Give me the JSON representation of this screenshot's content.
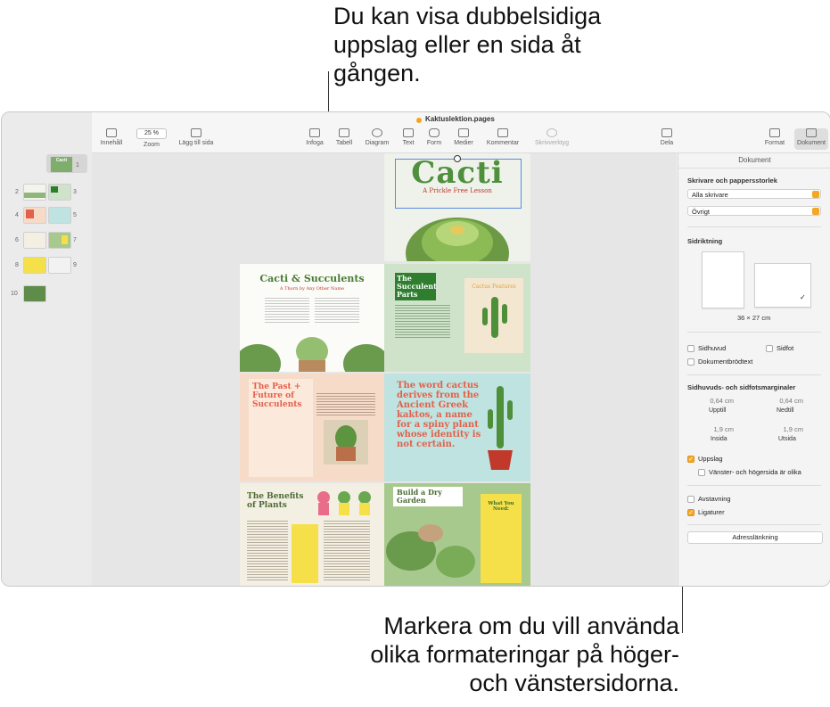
{
  "callouts": {
    "top": "Du kan visa dubbelsidiga uppslag eller en sida åt gången.",
    "bottom": "Markera om du vill använda olika formateringar på höger- och vänstersidorna."
  },
  "window": {
    "title": "Kaktuslektion.pages"
  },
  "toolbar": {
    "sidebar_label": "Innehåll",
    "zoom_value": "25 %",
    "zoom_label": "Zoom",
    "add_page_label": "Lägg till sida",
    "insert_label": "Infoga",
    "table_label": "Tabell",
    "chart_label": "Diagram",
    "text_label": "Text",
    "shape_label": "Form",
    "media_label": "Medier",
    "comment_label": "Kommentar",
    "writing_tools_label": "Skrivverktyg",
    "share_label": "Dela",
    "format_label": "Format",
    "document_label": "Dokument"
  },
  "thumbnails": [
    "1",
    "2",
    "3",
    "4",
    "5",
    "6",
    "7",
    "8",
    "9",
    "10"
  ],
  "pages": {
    "cover_title": "Cacti",
    "cover_subtitle": "A Prickle Free Lesson",
    "p2_title": "Cacti & Succulents",
    "p2_subtitle": "A Thorn by Any Other Name",
    "p3_title": "The Succulent Parts",
    "p3_sub": "Cactus Features",
    "p4_title": "The Past + Future of Succulents",
    "p5_text": "The word cactus derives from the Ancient Greek kaktos, a name for a spiny plant whose identity is not certain.",
    "p6_title": "The Benefits of Plants",
    "p7_title": "Build a Dry Garden",
    "p7_card": "What You Need:"
  },
  "inspector": {
    "tab": "Dokument",
    "printer_section": "Skrivare och pappersstorlek",
    "printer_value": "Alla skrivare",
    "paper_value": "Övrigt",
    "orientation_section": "Sidriktning",
    "size_text": "36 × 27 cm",
    "header_label": "Sidhuvud",
    "footer_label": "Sidfot",
    "body_label": "Dokumentbrödtext",
    "margins_section": "Sidhuvuds- och sidfotsmarginaler",
    "top_value": "0,64 cm",
    "top_label": "Upptill",
    "bottom_value": "0,64 cm",
    "bottom_label": "Nedtill",
    "inside_value": "1,9 cm",
    "inside_label": "Insida",
    "outside_value": "1,9 cm",
    "outside_label": "Utsida",
    "facing_label": "Uppslag",
    "left_right_label": "Vänster- och högersida är olika",
    "hyphenation_label": "Avstavning",
    "ligatures_label": "Ligaturer",
    "bookmarks_button": "Adresslänkning",
    "checkmark": "✓"
  },
  "colors": {
    "accent": "#f5a623",
    "green": "#3a8a3a",
    "coral": "#e3604b",
    "yellow": "#f6e04a"
  }
}
